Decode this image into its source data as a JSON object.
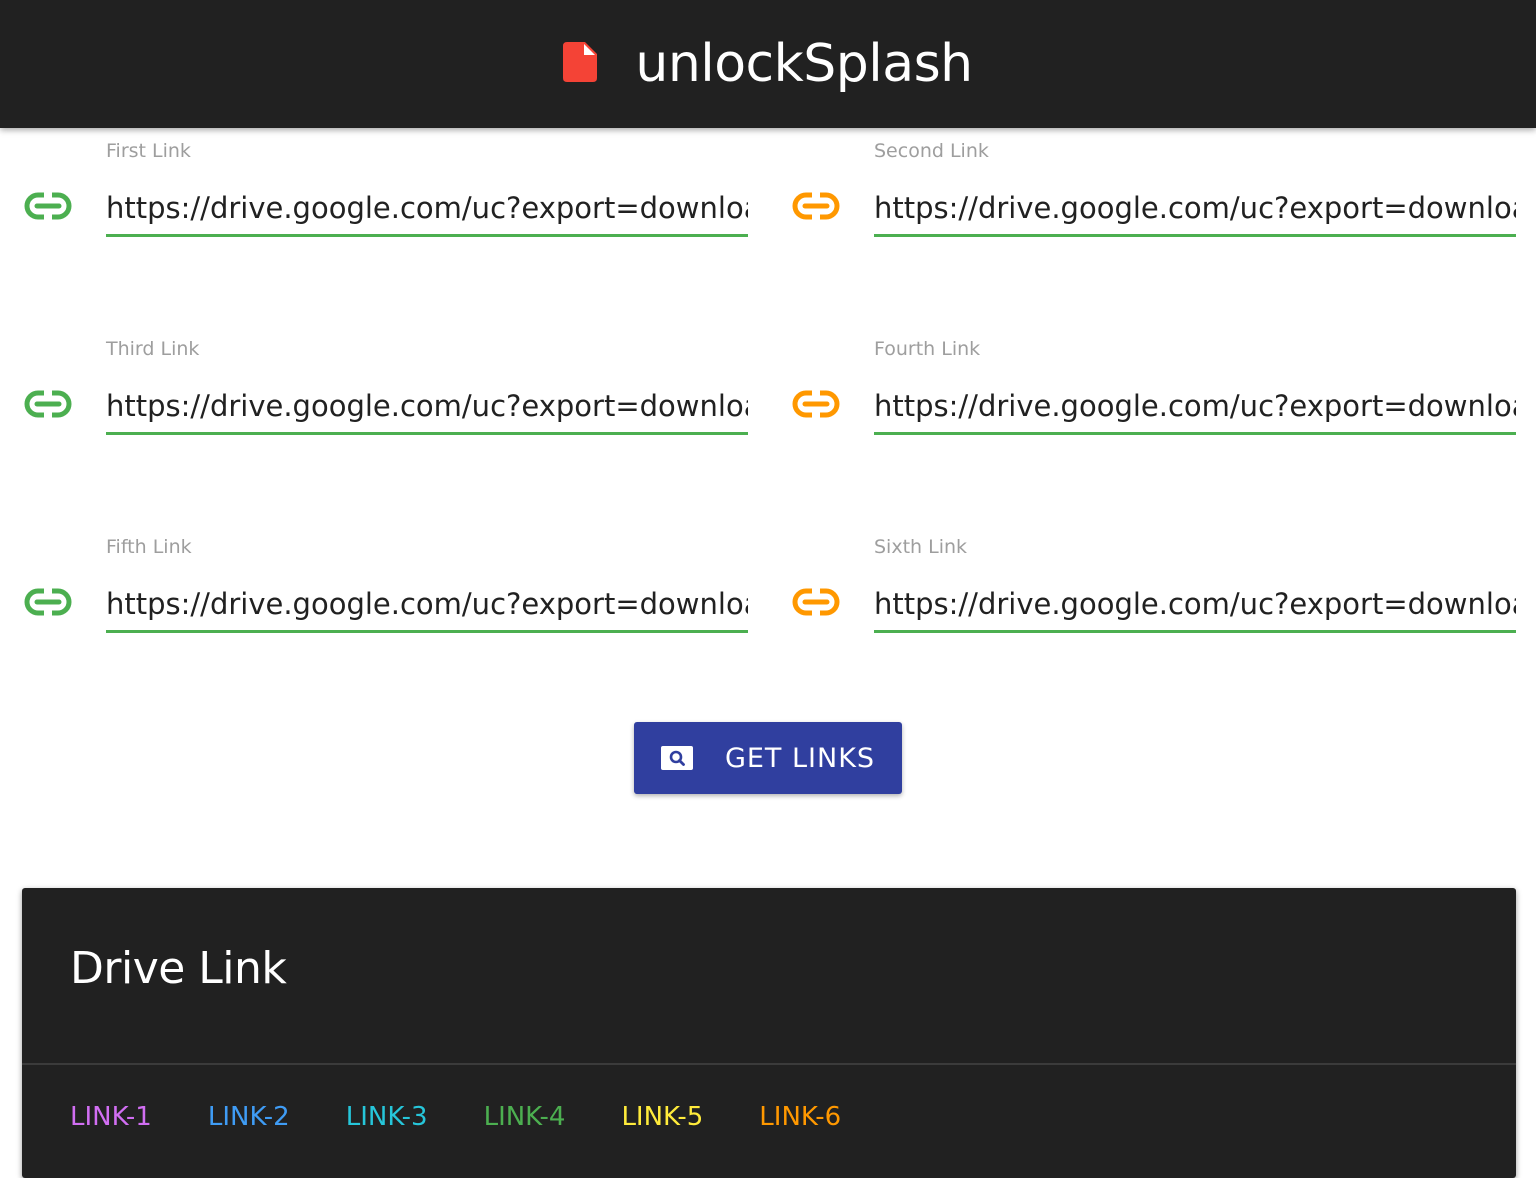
{
  "header": {
    "title": "unlockSplash",
    "icon": "file-icon",
    "icon_color": "#f44336"
  },
  "fields": [
    {
      "label": "First Link",
      "value": "https://drive.google.com/uc?export=downloa",
      "icon": "link-icon",
      "icon_color": "#4caf50"
    },
    {
      "label": "Second Link",
      "value": "https://drive.google.com/uc?export=downloa",
      "icon": "link-icon",
      "icon_color": "#ff9800"
    },
    {
      "label": "Third Link",
      "value": "https://drive.google.com/uc?export=downloa",
      "icon": "link-icon",
      "icon_color": "#4caf50"
    },
    {
      "label": "Fourth Link",
      "value": "https://drive.google.com/uc?export=downloa",
      "icon": "link-icon",
      "icon_color": "#ff9800"
    },
    {
      "label": "Fifth Link",
      "value": "https://drive.google.com/uc?export=downloa",
      "icon": "link-icon",
      "icon_color": "#4caf50"
    },
    {
      "label": "Sixth Link",
      "value": "https://drive.google.com/uc?export=downloa",
      "icon": "link-icon",
      "icon_color": "#ff9800"
    }
  ],
  "button": {
    "label": "GET LINKS",
    "icon": "image-search-icon",
    "color": "#303f9f"
  },
  "card": {
    "title": "Drive Link",
    "tabs": [
      {
        "label": "LINK-1",
        "color": "#d16ef2"
      },
      {
        "label": "LINK-2",
        "color": "#3f9cf5"
      },
      {
        "label": "LINK-3",
        "color": "#26c6da"
      },
      {
        "label": "LINK-4",
        "color": "#4caf50"
      },
      {
        "label": "LINK-5",
        "color": "#ffeb3b"
      },
      {
        "label": "LINK-6",
        "color": "#ff9800"
      }
    ]
  }
}
